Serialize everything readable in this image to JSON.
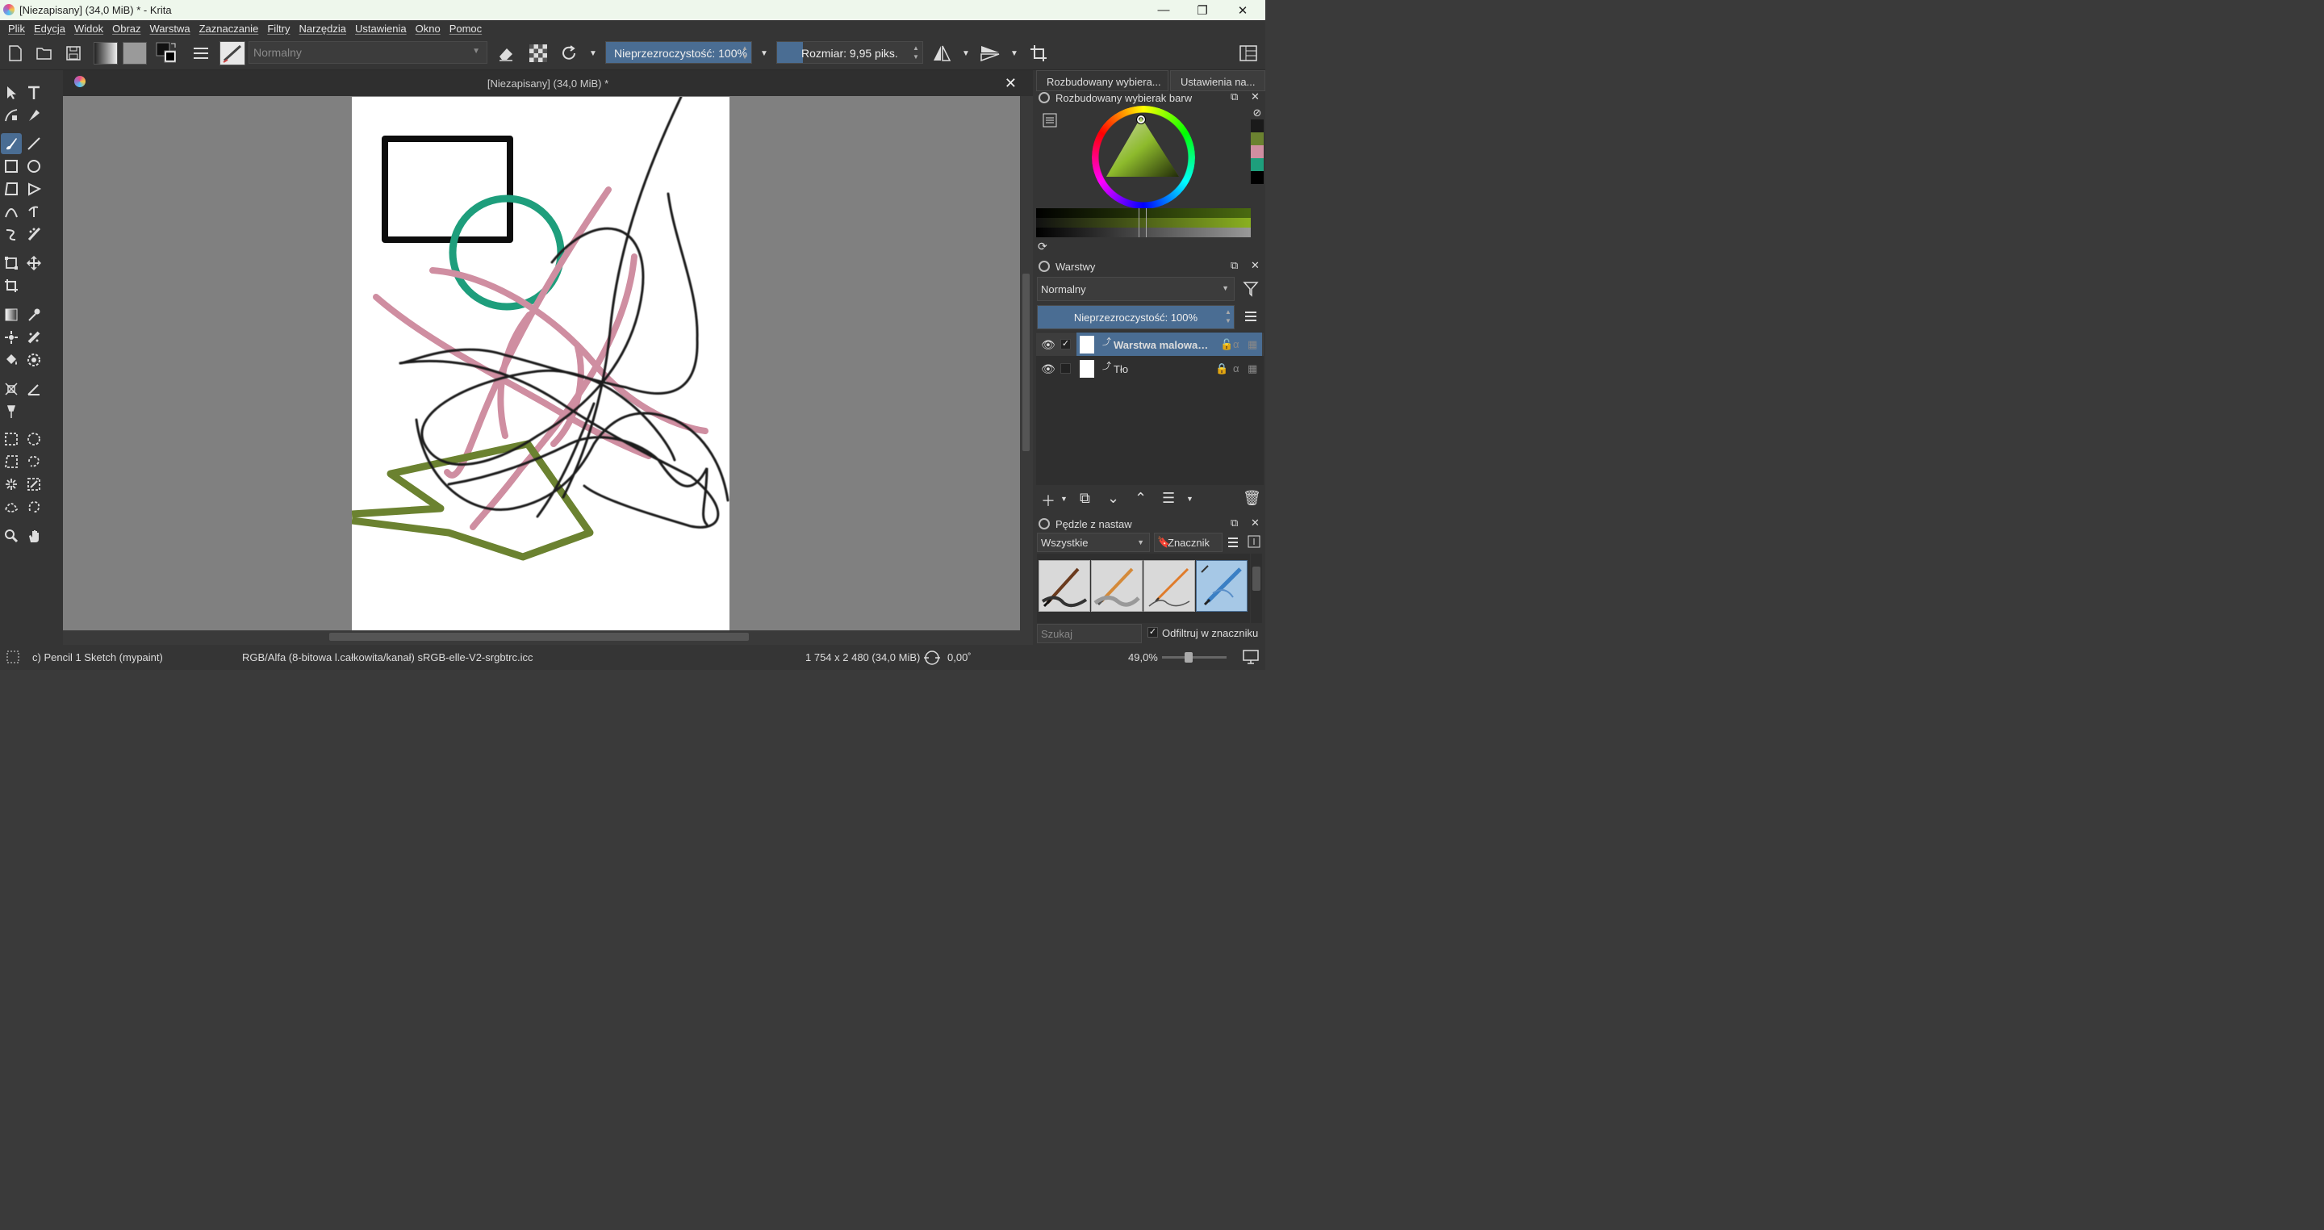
{
  "window": {
    "title": "[Niezapisany]  (34,0 MiB) * - Krita"
  },
  "menu": [
    "Plik",
    "Edycja",
    "Widok",
    "Obraz",
    "Warstwa",
    "Zaznaczanie",
    "Filtry",
    "Narzędzia",
    "Ustawienia",
    "Okno",
    "Pomoc"
  ],
  "toolbar": {
    "blend_mode": "Normalny",
    "opacity_label": "Nieprzezroczystość: 100%",
    "opacity_value": 100,
    "size_label": "Rozmiar: 9,95 piks.",
    "size_fraction": 0.03
  },
  "document": {
    "tab_title": "[Niezapisany]  (34,0 MiB) *"
  },
  "dock": {
    "tabs": [
      "Rozbudowany wybiera...",
      "Ustawienia na..."
    ],
    "color_panel_title": "Rozbudowany wybierak barw",
    "layers_panel_title": "Warstwy",
    "layers_blend_mode": "Normalny",
    "layers_opacity": "Nieprzezroczystość:  100%",
    "layers": [
      {
        "name": "Warstwa malowani...",
        "selected": true
      },
      {
        "name": "Tło",
        "selected": false
      }
    ],
    "brushes_panel_title": "Pędzle z nastaw",
    "brush_filter": "Wszystkie",
    "tag_label": "Znacznik",
    "search_placeholder": "Szukaj",
    "filter_in_tag_label": "Odfiltruj w znaczniku"
  },
  "status": {
    "brush_name": "c) Pencil 1 Sketch (mypaint)",
    "color_space": "RGB/Alfa (8-bitowa l.całkowita/kanał)  sRGB-elle-V2-srgbtrc.icc",
    "dimensions": "1 754 x 2 480 (34,0 MiB)",
    "rotation": "0,00˚",
    "zoom": "49,0%"
  },
  "colors": {
    "accent": "#4a6d93",
    "stroke_black": "#1a1a1a",
    "stroke_teal": "#1e9e7c",
    "stroke_pink": "#cf8ea1",
    "stroke_olive": "#6b8230"
  }
}
